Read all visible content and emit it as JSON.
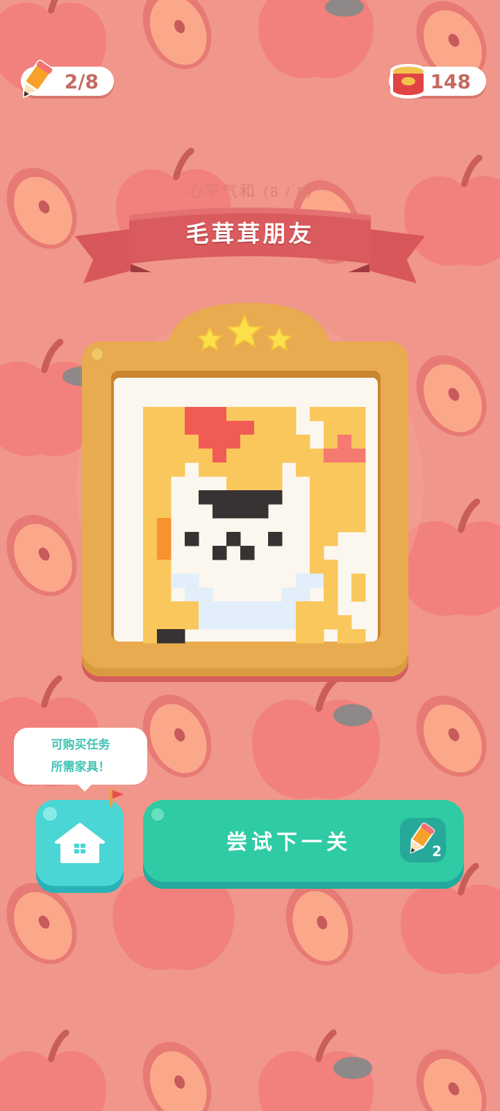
{
  "hud": {
    "level_progress": "2/8",
    "cans": "148"
  },
  "level": {
    "chapter": "心平气和",
    "chapter_count": "(8 / 8)",
    "title": "毛茸茸朋友",
    "stars_earned": 3
  },
  "tip": {
    "line1": "可购买任务",
    "line2": "所需家具！"
  },
  "buttons": {
    "next_label": "尝试下一关",
    "pencil_cost": "2"
  },
  "colors": {
    "background": "#f0968a",
    "frame": "#e8ab50",
    "primary_button": "#2ecba4",
    "home_button": "#49d6d4",
    "banner": "#d8575a"
  },
  "icons": {
    "hud_left": "pencil-icon",
    "hud_right": "fish-can-icon",
    "home": "house-icon",
    "cost": "pencil-icon"
  },
  "pixel_art": {
    "palette": {
      ".": "#fcf7ee",
      "Y": "#f9c75c",
      "R": "#f15b56",
      "P": "#f47a72",
      "K": "#393232",
      "W": "#fefcf6",
      "B": "#e2eef9",
      "O": "#f7922e"
    },
    "rows": [
      "YYYRRRYYYYY.YYYY",
      "YYYRRRRRYYY..YYY",
      "YYYYRRRYYYYY.YPY",
      "YYYYYRYYYYYYYPPP",
      "YYY.YYYYYY.YYYYY",
      "YY....YYYY..YYYY",
      "YY..KKKKKK..YYYY",
      "YY...KKKK...YYYY",
      "YO..........YYYY",
      "YO.K..K..K..YY..",
      "YO...K.K....Y...",
      "YY..........YY..",
      "YYBB.......BBY.Y",
      "YY.BB.....BB.Y.Y",
      "YYYYBBBBBBBYYY..",
      "YYYYBBBBBBBYYYY.",
      "YKK........YY.YY"
    ]
  }
}
